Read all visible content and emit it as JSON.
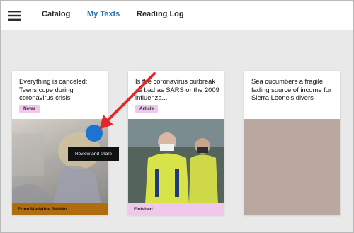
{
  "nav": {
    "items": [
      {
        "label": "Catalog"
      },
      {
        "label": "My Texts",
        "active": true
      },
      {
        "label": "Reading Log"
      }
    ]
  },
  "cards": [
    {
      "title": "Everything is canceled: Teens cope during coronavirus crisis",
      "badge": "News",
      "footer": "From Madeline Rabbitt",
      "footer_color": "#b06d10",
      "tooltip": "Review and share"
    },
    {
      "title": "Is the coronavirus outbreak as bad as SARS or the 2009 influenza...",
      "badge": "Article",
      "footer": "Finished",
      "footer_color": "#efc9ec"
    },
    {
      "title": "Sea cucumbers a fragile, fading source of income for Sierra Leone's divers"
    }
  ],
  "colors": {
    "accent": "#2a73b8",
    "badge": "#efc9ec",
    "cursor": "#1a74d4",
    "arrow": "#e0282a"
  },
  "icons": {
    "menu": "hamburger-icon"
  }
}
